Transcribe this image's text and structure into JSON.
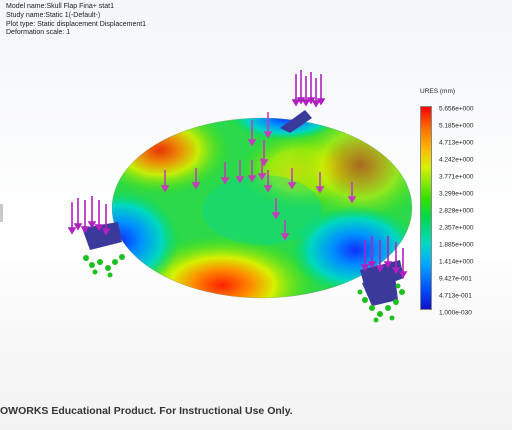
{
  "header": {
    "model_name": "Model name:Skull Flap Fina+ stat1",
    "study_name": "Study name:Static 1(-Default-)",
    "plot_type": "Plot type: Static displacement Displacement1",
    "deformation_scale": "Deformation scale: 1"
  },
  "legend": {
    "title": "URES (mm)",
    "ticks": [
      "5.656e+000",
      "5.185e+000",
      "4.713e+000",
      "4.242e+000",
      "3.771e+000",
      "3.299e+000",
      "2.828e+000",
      "2.357e+000",
      "1.885e+000",
      "1.414e+000",
      "9.427e-001",
      "4.713e-001",
      "1.000e-030"
    ]
  },
  "footer": {
    "watermark": "OWORKS Educational Product. For Instructional Use Only."
  }
}
